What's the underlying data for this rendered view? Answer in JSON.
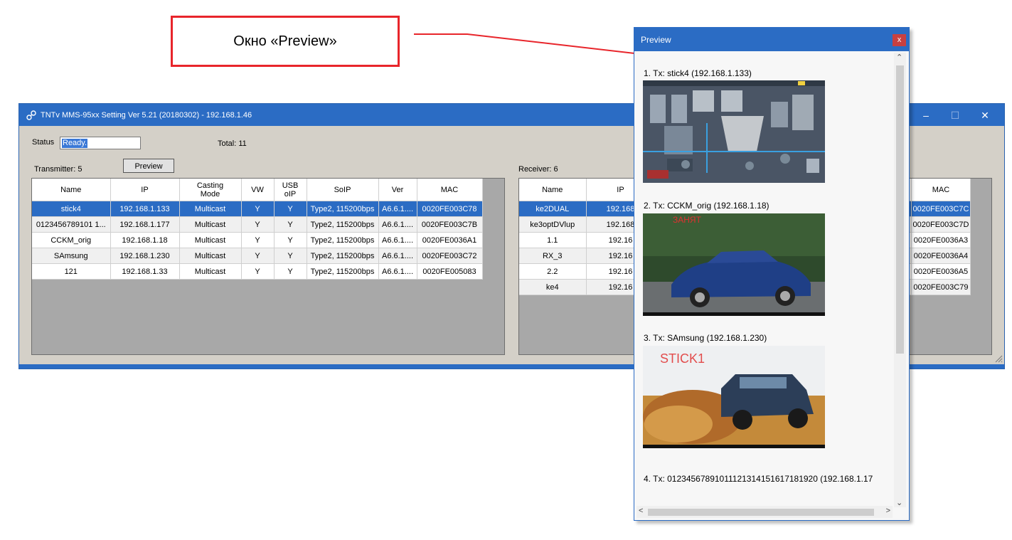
{
  "callout": {
    "text": "Окно «Preview»"
  },
  "main_window": {
    "title": "TNTv MMS-95xx Setting Ver 5.21 (20180302) - 192.168.1.46",
    "status_label": "Status",
    "status_value": "Ready.",
    "total_label": "Total: 11",
    "transmitter_label": "Transmitter: 5",
    "receiver_label": "Receiver: 6",
    "preview_button": "Preview",
    "controls": {
      "minimize": "–",
      "maximize": "☐",
      "close": "✕"
    }
  },
  "tx_table": {
    "headers": {
      "name": "Name",
      "ip": "IP",
      "casting1": "Casting",
      "casting2": "Mode",
      "vw": "VW",
      "usb1": "USB",
      "usb2": "oIP",
      "soip": "SoIP",
      "ver": "Ver",
      "mac": "MAC"
    },
    "rows": [
      {
        "name": "stick4",
        "ip": "192.168.1.133",
        "mode": "Multicast",
        "vw": "Y",
        "usb": "Y",
        "soip": "Type2, 115200bps",
        "ver": "A6.6.1....",
        "mac": "0020FE003C78"
      },
      {
        "name": "0123456789101 1...",
        "ip": "192.168.1.177",
        "mode": "Multicast",
        "vw": "Y",
        "usb": "Y",
        "soip": "Type2, 115200bps",
        "ver": "A6.6.1....",
        "mac": "0020FE003C7B"
      },
      {
        "name": "CCKM_orig",
        "ip": "192.168.1.18",
        "mode": "Multicast",
        "vw": "Y",
        "usb": "Y",
        "soip": "Type2, 115200bps",
        "ver": "A6.6.1....",
        "mac": "0020FE0036A1"
      },
      {
        "name": "SAmsung",
        "ip": "192.168.1.230",
        "mode": "Multicast",
        "vw": "Y",
        "usb": "Y",
        "soip": "Type2, 115200bps",
        "ver": "A6.6.1....",
        "mac": "0020FE003C72"
      },
      {
        "name": "121",
        "ip": "192.168.1.33",
        "mode": "Multicast",
        "vw": "Y",
        "usb": "Y",
        "soip": "Type2, 115200bps",
        "ver": "A6.6.1....",
        "mac": "0020FE005083"
      }
    ]
  },
  "rx_table": {
    "headers": {
      "name": "Name",
      "ip": "IP",
      "mac": "MAC"
    },
    "rows": [
      {
        "name": "ke2DUAL",
        "ip": "192.168",
        "mac": "0020FE003C7C"
      },
      {
        "name": "ke3optDVlup",
        "ip": "192.168",
        "mac": "0020FE003C7D"
      },
      {
        "name": "1.1",
        "ip": "192.16",
        "mac": "0020FE0036A3"
      },
      {
        "name": "RX_3",
        "ip": "192.16",
        "mac": "0020FE0036A4"
      },
      {
        "name": "2.2",
        "ip": "192.16",
        "mac": "0020FE0036A5"
      },
      {
        "name": "ke4",
        "ip": "192.16",
        "mac": "0020FE003C79"
      }
    ]
  },
  "preview_window": {
    "title": "Preview",
    "close": "x",
    "items": [
      {
        "label": "1. Tx: stick4 (192.168.1.133)"
      },
      {
        "label": "2. Tx: CCKM_orig (192.168.1.18)",
        "overlay": "ЗАНЯТ"
      },
      {
        "label": "3. Tx: SAmsung (192.168.1.230)",
        "overlay": "STICK1"
      },
      {
        "label": "4. Tx: 01234567891011121314151617181920 (192.168.1.17"
      }
    ]
  },
  "colors": {
    "titlebar": "#2b6cc4",
    "callout_border": "#e8252b",
    "selection": "#2b6cc4"
  }
}
